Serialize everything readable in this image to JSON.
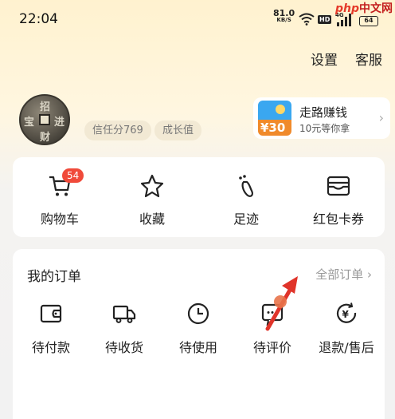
{
  "status_bar": {
    "time": "22:04",
    "net_speed": "81.0",
    "net_unit": "KB/S",
    "hd_label": "HD",
    "signal_label": "4G",
    "battery": "64",
    "watermark_brand": "php",
    "watermark_text": "中文网"
  },
  "header": {
    "settings": "设置",
    "service": "客服"
  },
  "profile": {
    "avatar_chars": [
      "招",
      "财",
      "进",
      "宝"
    ],
    "credit": "信任分769",
    "growth": "成长值"
  },
  "promo": {
    "badge_amount": "¥30",
    "title": "走路赚钱",
    "subtitle": "10元等你拿"
  },
  "quick_actions": [
    {
      "label": "购物车",
      "icon": "cart-icon",
      "badge": "54"
    },
    {
      "label": "收藏",
      "icon": "star-icon"
    },
    {
      "label": "足迹",
      "icon": "footprint-icon"
    },
    {
      "label": "红包卡券",
      "icon": "wallet-card-icon"
    }
  ],
  "orders": {
    "title": "我的订单",
    "all": "全部订单",
    "items": [
      {
        "label": "待付款",
        "icon": "wallet-icon"
      },
      {
        "label": "待收货",
        "icon": "truck-icon"
      },
      {
        "label": "待使用",
        "icon": "clock-icon"
      },
      {
        "label": "待评价",
        "icon": "comment-icon"
      },
      {
        "label": "退款/售后",
        "icon": "refund-icon"
      }
    ]
  },
  "colors": {
    "badge_red": "#f04a3a",
    "annotation_red": "#e0342a",
    "header_gradient": "#fff2cf"
  }
}
